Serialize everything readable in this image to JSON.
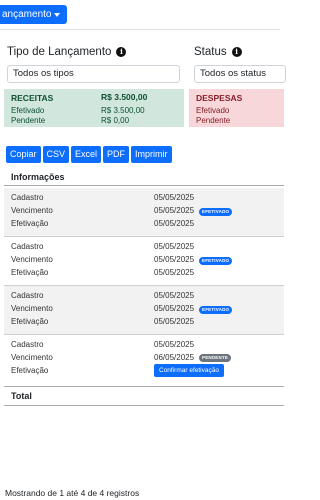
{
  "topbar": {
    "menu_label": "ançamento"
  },
  "filters": {
    "tipo": {
      "label": "Tipo de Lançamento",
      "value": "Todos os tipos"
    },
    "status": {
      "label": "Status",
      "value": "Todos os status"
    }
  },
  "cards": {
    "receitas": {
      "title": "RECEITAS",
      "total": "R$ 3.500,00",
      "efetivado_label": "Efetivado",
      "efetivado_value": "R$ 3.500,00",
      "pendente_label": "Pendente",
      "pendente_value": "R$ 0,00"
    },
    "despesas": {
      "title": "DESPESAS",
      "efetivado_label": "Efetivado",
      "pendente_label": "Pendente"
    }
  },
  "export_buttons": [
    "Copiar",
    "CSV",
    "Excel",
    "PDF",
    "Imprimir"
  ],
  "table": {
    "header": "Informações",
    "entries": [
      {
        "cadastro_label": "Cadastro",
        "cadastro": "05/05/2025",
        "vencimento_label": "Vencimento",
        "vencimento": "05/05/2025",
        "badge": "EFETIVADO",
        "efetivacao_label": "Efetivação",
        "efetivacao": "05/05/2025"
      },
      {
        "cadastro_label": "Cadastro",
        "cadastro": "05/05/2025",
        "vencimento_label": "Vencimento",
        "vencimento": "05/05/2025",
        "badge": "EFETIVADO",
        "efetivacao_label": "Efetivação",
        "efetivacao": "05/05/2025"
      },
      {
        "cadastro_label": "Cadastro",
        "cadastro": "05/05/2025",
        "vencimento_label": "Vencimento",
        "vencimento": "05/05/2025",
        "badge": "EFETIVADO",
        "efetivacao_label": "Efetivação",
        "efetivacao": "05/05/2025"
      },
      {
        "cadastro_label": "Cadastro",
        "cadastro": "05/05/2025",
        "vencimento_label": "Vencimento",
        "vencimento": "06/05/2025",
        "badge": "PENDENTE",
        "efetivacao_label": "Efetivação",
        "action": "Confirmar efetivação"
      }
    ],
    "total_label": "Total"
  },
  "footer": {
    "info": "Mostrando de 1 até 4 de 4 registros"
  },
  "colors": {
    "primary": "#0d6efd",
    "success_bg": "#d1e7dd",
    "danger_bg": "#f8d7da",
    "badge_pending": "#6c757d"
  }
}
